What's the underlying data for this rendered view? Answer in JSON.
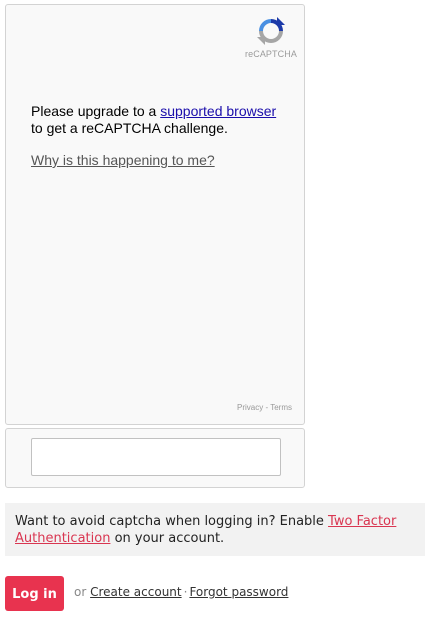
{
  "recaptcha": {
    "logo_text": "reCAPTCHA",
    "upgrade_prefix": "Please upgrade to a ",
    "upgrade_link": "supported browser",
    "upgrade_suffix": " to get a reCAPTCHA challenge.",
    "why_link": "Why is this happening to me?",
    "privacy_link": "Privacy",
    "footer_separator": " - ",
    "terms_link": "Terms",
    "response_input_value": ""
  },
  "tfa_notice": {
    "text_before": "Want to avoid captcha when logging in? Enable ",
    "link_text": "Two Factor Authentication",
    "text_after": " on your account."
  },
  "login": {
    "button_label": "Log in",
    "or_text": "or",
    "create_account": "Create account",
    "separator": "·",
    "forgot_password": "Forgot password"
  },
  "colors": {
    "accent": "#e8334f",
    "link_blue": "#1a0dab",
    "tfa_link": "#d93651"
  }
}
